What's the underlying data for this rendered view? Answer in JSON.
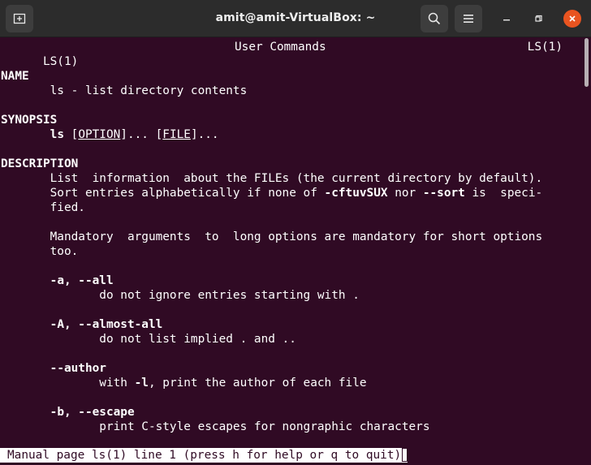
{
  "window": {
    "title": "amit@amit-VirtualBox: ~",
    "icons": {
      "new_tab": "new-tab-icon",
      "search": "search-icon",
      "menu": "hamburger-menu-icon",
      "minimize": "minimize-icon",
      "maximize": "maximize-icon",
      "close": "close-icon"
    },
    "colors": {
      "background": "#300a24",
      "titlebar": "#2c2c2c",
      "close": "#e95420",
      "text": "#ffffff"
    }
  },
  "man": {
    "header_left": "LS(1)",
    "header_center": "User Commands",
    "header_right": "LS(1)",
    "name_heading": "NAME",
    "name_line": "       ls - list directory contents",
    "synopsis_heading": "SYNOPSIS",
    "synopsis": {
      "indent": "       ",
      "cmd": "ls",
      "open1": " [",
      "option": "OPTION",
      "close1": "]... [",
      "file": "FILE",
      "close2": "]..."
    },
    "description_heading": "DESCRIPTION",
    "desc1": "       List  information  about the FILEs (the current directory by default).",
    "desc2": {
      "pre": "       Sort entries alphabetically if none of ",
      "flags": "-cftuvSUX",
      "mid": " nor ",
      "sort": "--sort",
      "post": " is  speci-"
    },
    "desc3": "       fied.",
    "desc4": "       Mandatory  arguments  to  long options are mandatory for short options",
    "desc5": "       too.",
    "opt_a": {
      "indent": "       ",
      "flag": "-a, --all",
      "desc": "              do not ignore entries starting with ."
    },
    "opt_A": {
      "indent": "       ",
      "flag": "-A, --almost-all",
      "desc": "              do not list implied . and .."
    },
    "opt_author": {
      "indent": "       ",
      "flag": "--author",
      "desc_pre": "              with ",
      "desc_flag": "-l",
      "desc_post": ", print the author of each file"
    },
    "opt_b": {
      "indent": "       ",
      "flag": "-b, --escape",
      "desc": "              print C-style escapes for nongraphic characters"
    },
    "status": "Manual page ls(1) line 1 (press h for help or q to quit)"
  }
}
